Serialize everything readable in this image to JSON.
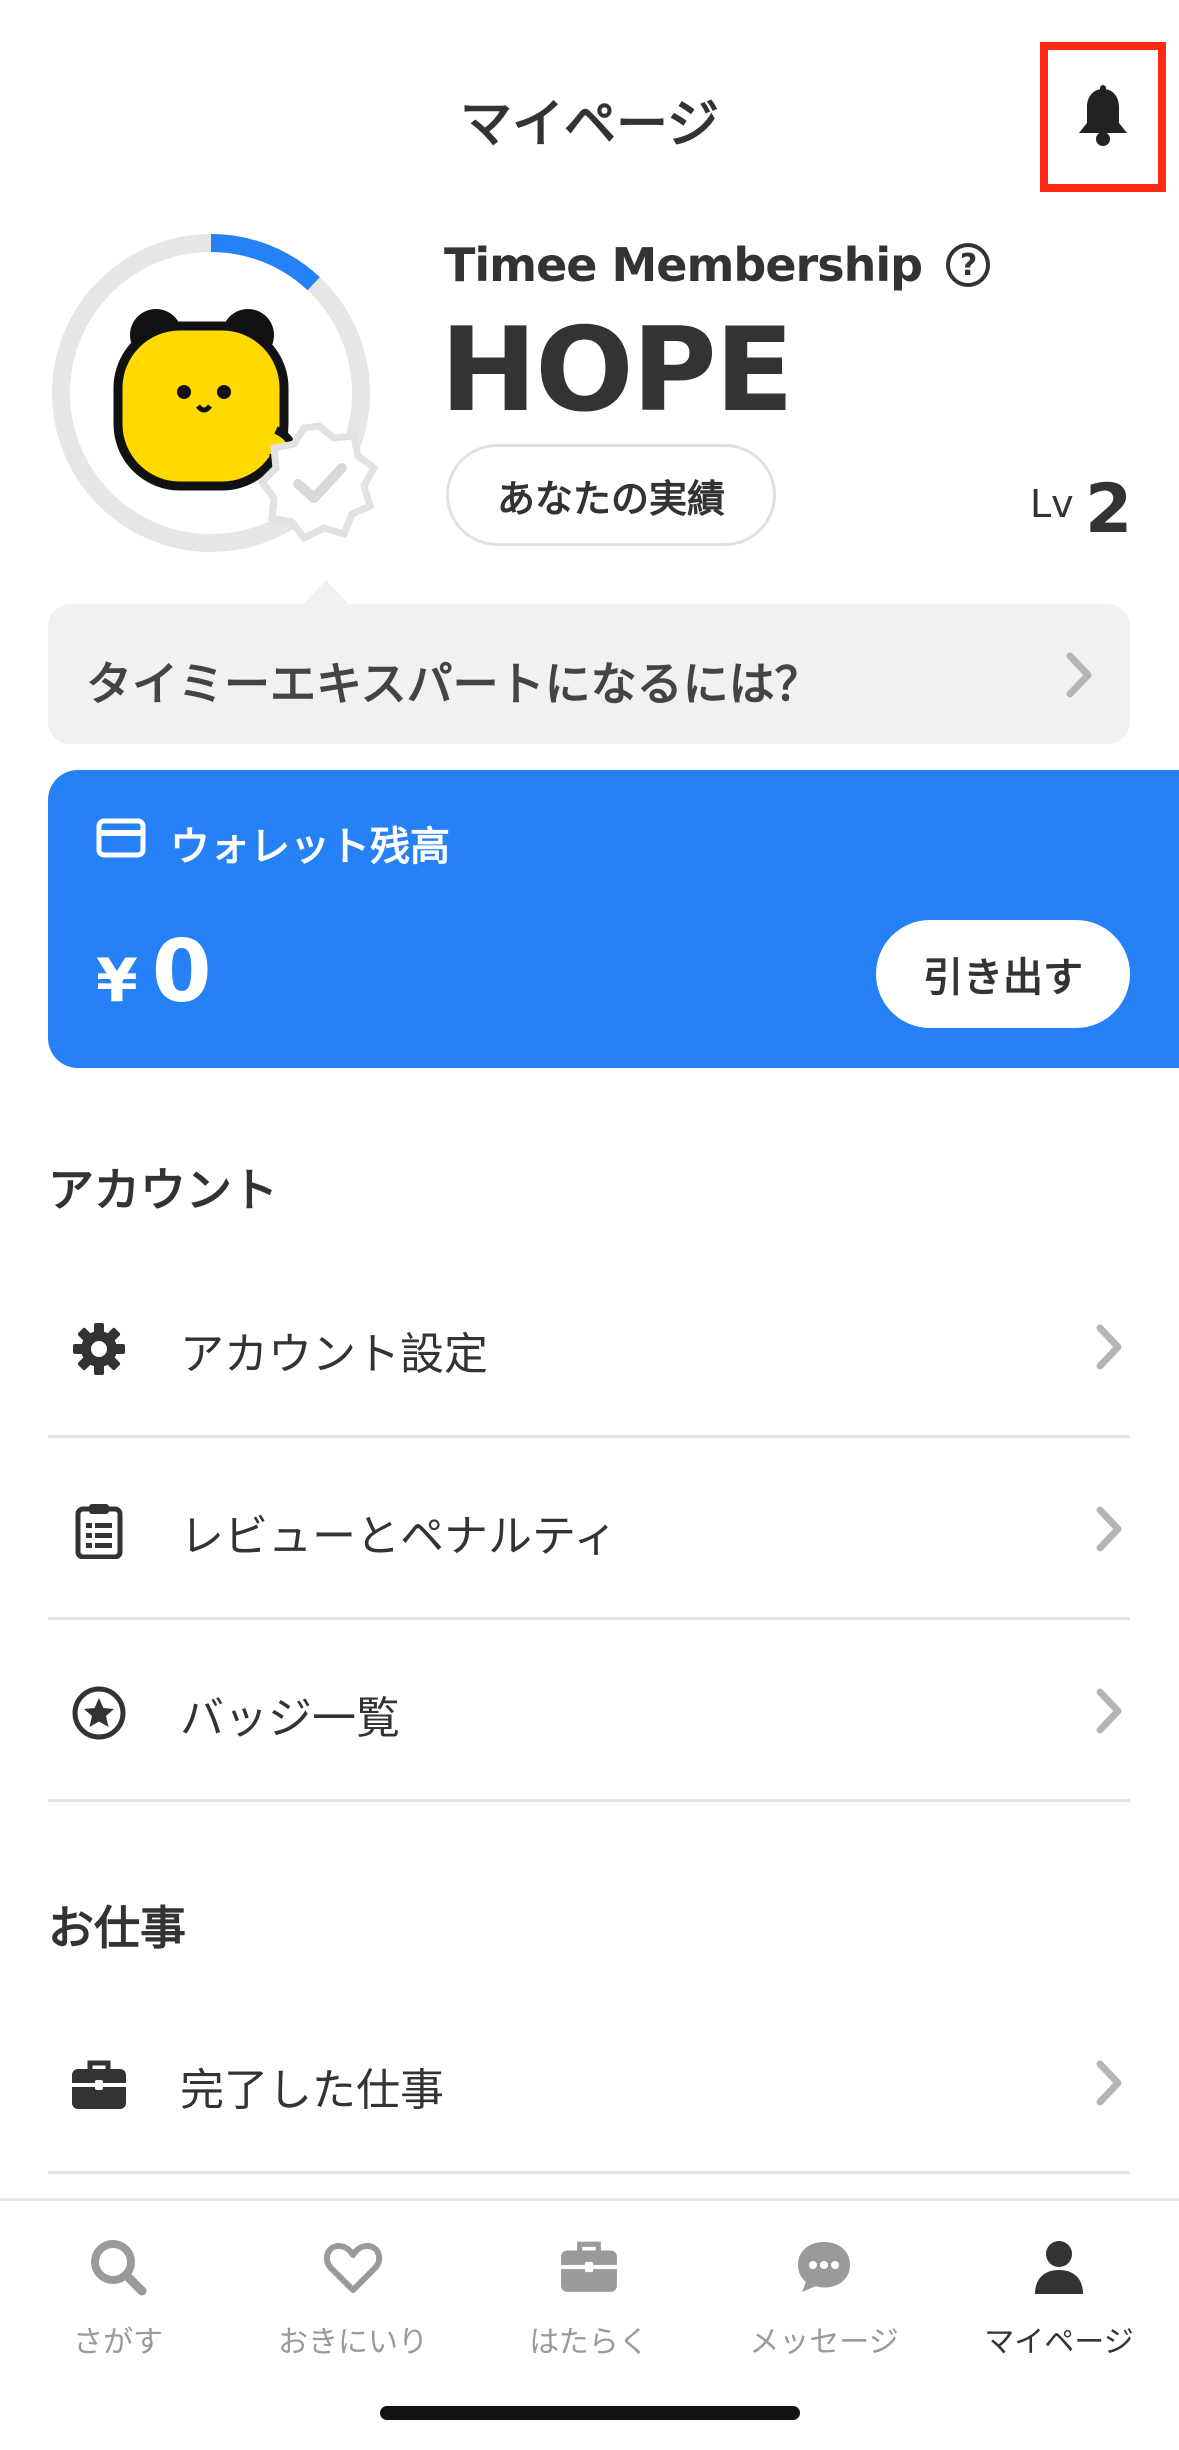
{
  "header": {
    "title": "マイページ",
    "bell_icon": "bell-icon"
  },
  "profile": {
    "membership_label": "Timee Membership",
    "help_icon": "question-circle-icon",
    "help_glyph": "?",
    "rank": "HOPE",
    "achievements_label": "あなたの実績",
    "level_prefix": "Lv",
    "level": "2",
    "progress_fraction": 0.12
  },
  "expert_banner": {
    "text": "タイミーエキスパートになるには？"
  },
  "wallet": {
    "title": "ウォレット残高",
    "currency": "¥",
    "amount": "0",
    "withdraw_label": "引き出す",
    "color": "#2681f7"
  },
  "account_section": {
    "title": "アカウント",
    "items": [
      {
        "label": "アカウント設定",
        "icon": "gear-icon"
      },
      {
        "label": "レビューとペナルティ",
        "icon": "clipboard-icon"
      },
      {
        "label": "バッジ一覧",
        "icon": "star-circle-icon"
      }
    ]
  },
  "work_section": {
    "title": "お仕事",
    "items": [
      {
        "label": "完了した仕事",
        "icon": "briefcase-icon"
      }
    ]
  },
  "tabbar": {
    "tabs": [
      {
        "label": "さがす",
        "icon": "search-icon",
        "active": false
      },
      {
        "label": "おきにいり",
        "icon": "heart-icon",
        "active": false
      },
      {
        "label": "はたらく",
        "icon": "briefcase-icon",
        "active": false
      },
      {
        "label": "メッセージ",
        "icon": "chat-icon",
        "active": false
      },
      {
        "label": "マイページ",
        "icon": "person-icon",
        "active": true
      }
    ]
  }
}
